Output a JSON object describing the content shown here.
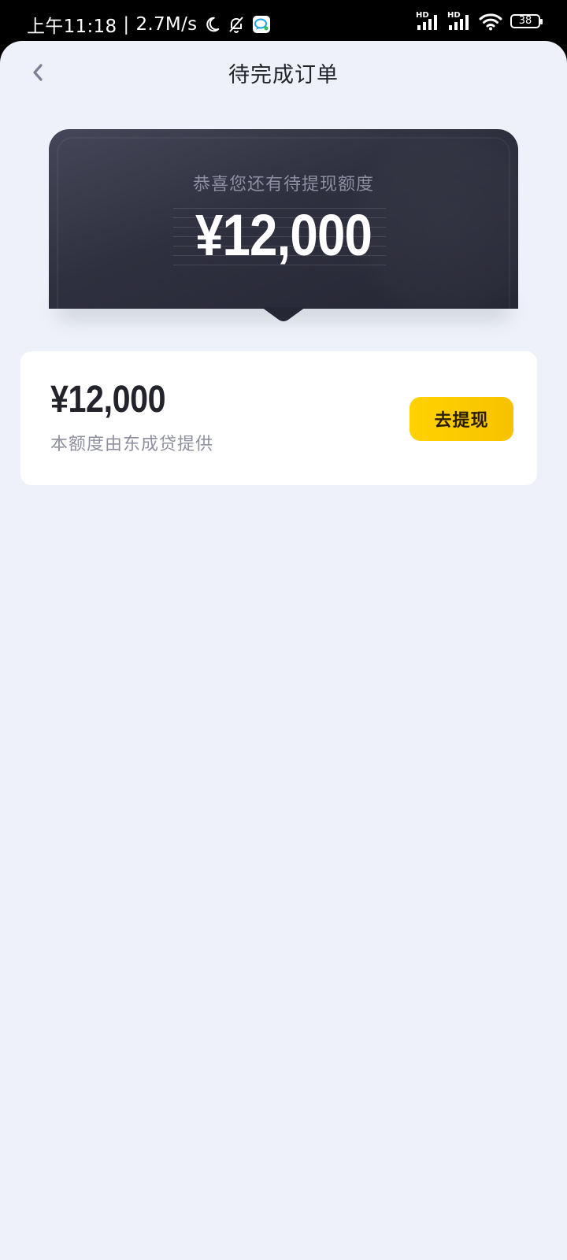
{
  "status_bar": {
    "time": "上午11:18",
    "separator": "|",
    "speed": "2.7M/s",
    "icons": [
      "moon-icon",
      "bell-off-icon",
      "chat-app-icon",
      "hd-signal-icon",
      "hd-signal-icon",
      "wifi-icon",
      "battery-icon"
    ],
    "signal_label_1": "HD",
    "signal_label_2": "HD",
    "battery": "38"
  },
  "nav": {
    "back_icon": "chevron-left-icon",
    "title": "待完成订单"
  },
  "hero": {
    "label": "恭喜您还有待提现额度",
    "amount": "¥12,000"
  },
  "quota_card": {
    "amount": "¥12,000",
    "provider": "本额度由东成贷提供",
    "button_label": "去提现"
  },
  "colors": {
    "page_bg": "#eef1f9",
    "hero_bg": "#2f303f",
    "button_yellow": "#ffd200",
    "text_dark": "#22232b",
    "text_muted": "#8e90a0"
  }
}
